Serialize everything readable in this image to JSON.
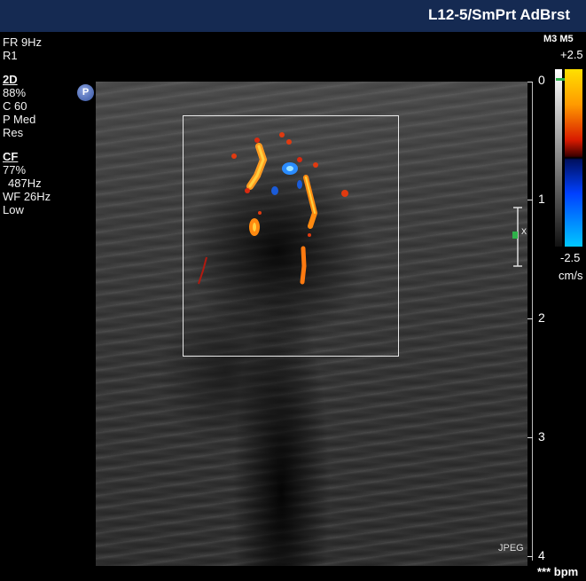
{
  "header": {
    "probe_preset": "L12-5/SmPrt AdBrst"
  },
  "params": {
    "fr": "FR 9Hz",
    "r": "R1",
    "twod_hdr": "2D",
    "twod_gain": "88%",
    "twod_c": "C 60",
    "twod_p": "P Med",
    "twod_res": "Res",
    "cf_hdr": "CF",
    "cf_gain": "77%",
    "cf_prf": "487Hz",
    "cf_wf": "WF 26Hz",
    "cf_low": "Low"
  },
  "badge": {
    "label": "P"
  },
  "depth_scale": {
    "labels": [
      "0",
      "1",
      "2",
      "3",
      "4"
    ]
  },
  "colorbar": {
    "header": "M3 M5",
    "top_value": "+2.5",
    "bottom_value": "-2.5",
    "unit": "cm/s"
  },
  "focus_label": "X",
  "footer": {
    "format": "JPEG",
    "bpm": "*** bpm"
  },
  "colors": {
    "header_bg": "#152a52",
    "roi": "#e8e8e8",
    "flow_red": "#e03a10",
    "flow_orange": "#ff9a20",
    "flow_blue": "#2a8cff"
  }
}
